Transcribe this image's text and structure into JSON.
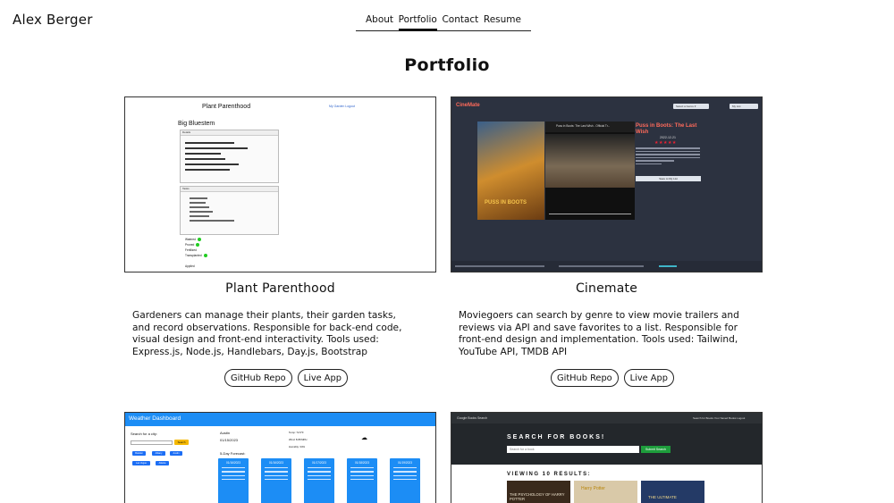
{
  "header": {
    "brand": "Alex Berger",
    "nav": [
      "About",
      "Portfolio",
      "Contact",
      "Resume"
    ],
    "active_nav": "Portfolio"
  },
  "page": {
    "title": "Portfolio"
  },
  "projects": [
    {
      "title": "Plant Parenthood",
      "description": "Gardeners can manage their plants, their garden tasks, and record observations. Responsible for back-end code, visual design and front-end interactivity. Tools used: Express.js, Node.js, Handlebars, Day.js, Bootstrap",
      "buttons": [
        "GitHub Repo",
        "Live App"
      ],
      "shot": {
        "heading": "Plant Parenthood",
        "links": "My Garden  Logout",
        "plant": "Big Bluestem",
        "panel1": "Details",
        "panel2": "Tasks",
        "tags": [
          "Watered",
          "Pruned",
          "Fertilized",
          "Transplanted",
          "Applied"
        ]
      }
    },
    {
      "title": "Cinemate",
      "description": "Moviegoers can search by genre to view movie trailers and reviews via API and save favorites to a list. Responsible for front-end design and implementation. Tools used: Tailwind, YouTube API, TMDB API",
      "buttons": [
        "GitHub Repo",
        "Live App"
      ],
      "shot": {
        "logo": "CineMate",
        "genre_select": "Select a Genre ▾",
        "my_list": "My List",
        "poster_text": "PUSS IN BOOTS",
        "video_title": "Puss in Boots: The Last Wish - Official Tr...",
        "movie_title": "Puss in Boots: The Last Wish",
        "release_date": "2022-12-21",
        "stars": "★★★★★",
        "save_button": "Save to My List"
      }
    },
    {
      "shot": {
        "title": "Weather Dashboard",
        "search_label": "Search for a city:",
        "search_button": "Search",
        "cities": [
          "Boulder",
          "Albany",
          "Austin",
          "Las Vegas",
          "Atlanta"
        ],
        "current_city": "Austin",
        "current_date": "01/15/2023",
        "current_stats": [
          "Temp: 72.9°F",
          "Wind: 8.88 MPH",
          "Humidity: 34%"
        ],
        "forecast_label": "5-Day Forecast:",
        "forecast_dates": [
          "01/16/2023",
          "01/16/2023",
          "01/17/2023",
          "01/18/2023",
          "01/19/2023"
        ]
      }
    },
    {
      "shot": {
        "brand": "Google Books Search",
        "nav_links": "Search for Books  Your Saved Books  Logout",
        "heading": "SEARCH FOR BOOKS!",
        "placeholder": "Search for a book",
        "submit": "Submit Search",
        "results": "VIEWING 10 RESULTS:",
        "book_titles": [
          "THE PSYCHOLOGY OF HARRY POTTER",
          "Harry Potter",
          "THE ULTIMATE"
        ]
      }
    }
  ],
  "colors": {
    "cinemate_bg": "#2c3240",
    "cinemate_accent": "#ff6a5a",
    "weather_blue": "#1c8df5",
    "weather_search": "#f5b800",
    "books_dark": "#23272b",
    "books_green": "#1e9d3c"
  }
}
